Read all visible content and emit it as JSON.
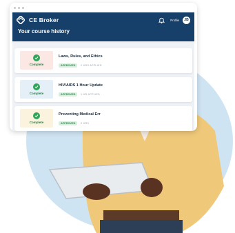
{
  "app": {
    "brand": "CE Broker",
    "profile_label": "Profile",
    "avatar_initials": "JB",
    "page_title": "Your course history"
  },
  "courses": [
    {
      "status": "Complete",
      "title": "Laws, Rules, and Ethics",
      "badge": "APPROVED",
      "hours": "2 HRS APPLIED",
      "badge_color": "#fbe7e4"
    },
    {
      "status": "Complete",
      "title": "HIV/AIDS 1 Hour Update",
      "badge": "APPROVED",
      "hours": "1 HR APPLIED",
      "badge_color": "#e4eff8"
    },
    {
      "status": "Complete",
      "title": "Preventing Medical Err",
      "badge": "APPROVED",
      "hours": "2 HRS",
      "badge_color": "#fbf3de"
    }
  ],
  "colors": {
    "header": "#163f69",
    "approved_text": "#2f8a4f",
    "check": "#2fa55a",
    "photo_bg": "#cfe4f3"
  }
}
